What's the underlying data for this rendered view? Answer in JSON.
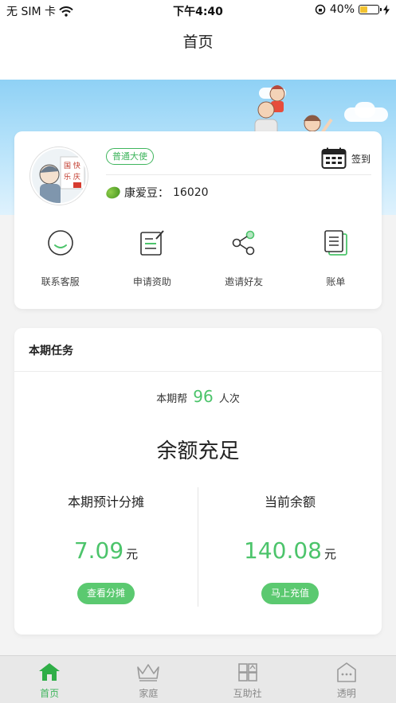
{
  "status_bar": {
    "carrier": "无 SIM 卡",
    "time": "下午4:40",
    "battery": "40%"
  },
  "nav": {
    "title": "首页"
  },
  "profile": {
    "badge": "普通大使",
    "beans_label": "康爱豆：",
    "beans_value": "16020",
    "signin_label": "签到"
  },
  "actions": [
    {
      "label": "联系客服",
      "icon": "chat-icon"
    },
    {
      "label": "申请资助",
      "icon": "application-icon"
    },
    {
      "label": "邀请好友",
      "icon": "share-icon"
    },
    {
      "label": "账单",
      "icon": "bill-icon"
    }
  ],
  "task": {
    "title": "本期任务",
    "helped_prefix": "本期帮",
    "helped_count": "96",
    "helped_suffix": "人次",
    "status": "余额充足",
    "estimate": {
      "head": "本期预计分摊",
      "amount": "7.09",
      "unit": "元",
      "button": "查看分摊"
    },
    "balance": {
      "head": "当前余额",
      "amount": "140.08",
      "unit": "元",
      "button": "马上充值"
    }
  },
  "tabs": [
    {
      "label": "首页",
      "icon": "home-icon",
      "active": true
    },
    {
      "label": "家庭",
      "icon": "crown-icon",
      "active": false
    },
    {
      "label": "互助社",
      "icon": "community-icon",
      "active": false
    },
    {
      "label": "透明",
      "icon": "building-icon",
      "active": false
    }
  ],
  "colors": {
    "accent": "#4cc46b",
    "banner_sky": "#8fd1f5"
  }
}
